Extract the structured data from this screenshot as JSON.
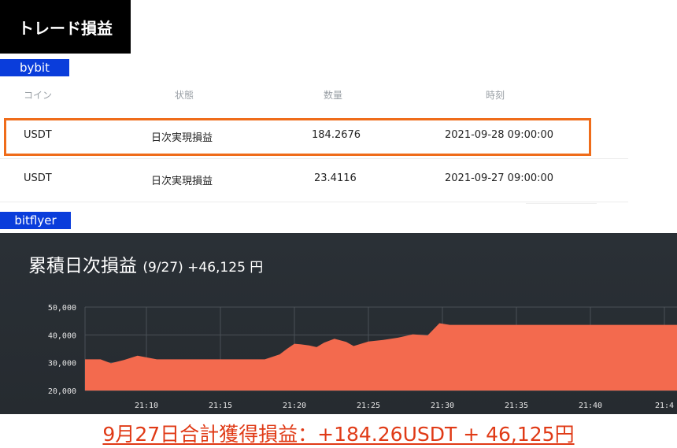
{
  "title": "トレード損益",
  "bybit": {
    "label": "bybit",
    "label_color": "#0a3ddb",
    "headers": [
      "コイン",
      "状態",
      "数量",
      "時刻"
    ],
    "rows": [
      {
        "coin": "USDT",
        "status": "日次実現損益",
        "qty": "184.2676",
        "time": "2021-09-28 09:00:00",
        "highlighted": true
      },
      {
        "coin": "USDT",
        "status": "日次実現損益",
        "qty": "23.4116",
        "time": "2021-09-27 09:00:00",
        "highlighted": false
      }
    ],
    "highlight_color": "#ef6c1a"
  },
  "bitflyer": {
    "label": "bitflyer",
    "label_color": "#0a3ddb",
    "chart_title_main": "累積日次損益",
    "chart_title_sub": "(9/27) +46,125 円"
  },
  "chart_data": {
    "type": "area",
    "title": "累積日次損益 (9/27) +46,125 円",
    "xlabel": "",
    "ylabel": "",
    "x_ticks": [
      "21:10",
      "21:15",
      "21:20",
      "21:25",
      "21:30",
      "21:35",
      "21:40",
      "21:4"
    ],
    "y_ticks": [
      "50,000",
      "40,000",
      "30,000",
      "20,000"
    ],
    "ylim": [
      20000,
      50000
    ],
    "x_minutes": [
      6.4,
      6.9,
      7.6,
      8.5,
      9.4,
      10.7,
      11.3,
      12.0,
      13.0,
      14.0,
      15.0,
      16.0,
      17.0,
      18.0,
      19.0,
      19.5,
      20.0,
      20.4,
      21.0,
      21.5,
      22.0,
      22.7,
      23.5,
      24.0,
      25.0,
      26.0,
      27.0,
      28.0,
      29.0,
      29.8,
      30.5,
      31.0,
      32.0,
      33.0,
      34.0,
      35.0,
      36.0,
      37.0,
      38.0,
      39.0,
      40.0,
      41.0,
      41.5
    ],
    "values": [
      31200,
      31200,
      29800,
      31000,
      32500,
      31200,
      31200,
      31200,
      31200,
      31200,
      31200,
      31200,
      31200,
      31200,
      33000,
      35000,
      36800,
      36600,
      36200,
      35600,
      37200,
      38600,
      37500,
      36000,
      37600,
      38200,
      39000,
      40200,
      39800,
      44200,
      43600,
      43600,
      43600,
      43600,
      43600,
      43600,
      43600,
      43600,
      43600,
      43600,
      43600,
      43600,
      43600
    ],
    "fill_color": "#f36a4e",
    "grid": true
  },
  "summary": "9月27日合計獲得損益：+184.26USDT + 46,125円",
  "colors": {
    "summary": "#e03a16",
    "chart_bg": "#282d33"
  }
}
